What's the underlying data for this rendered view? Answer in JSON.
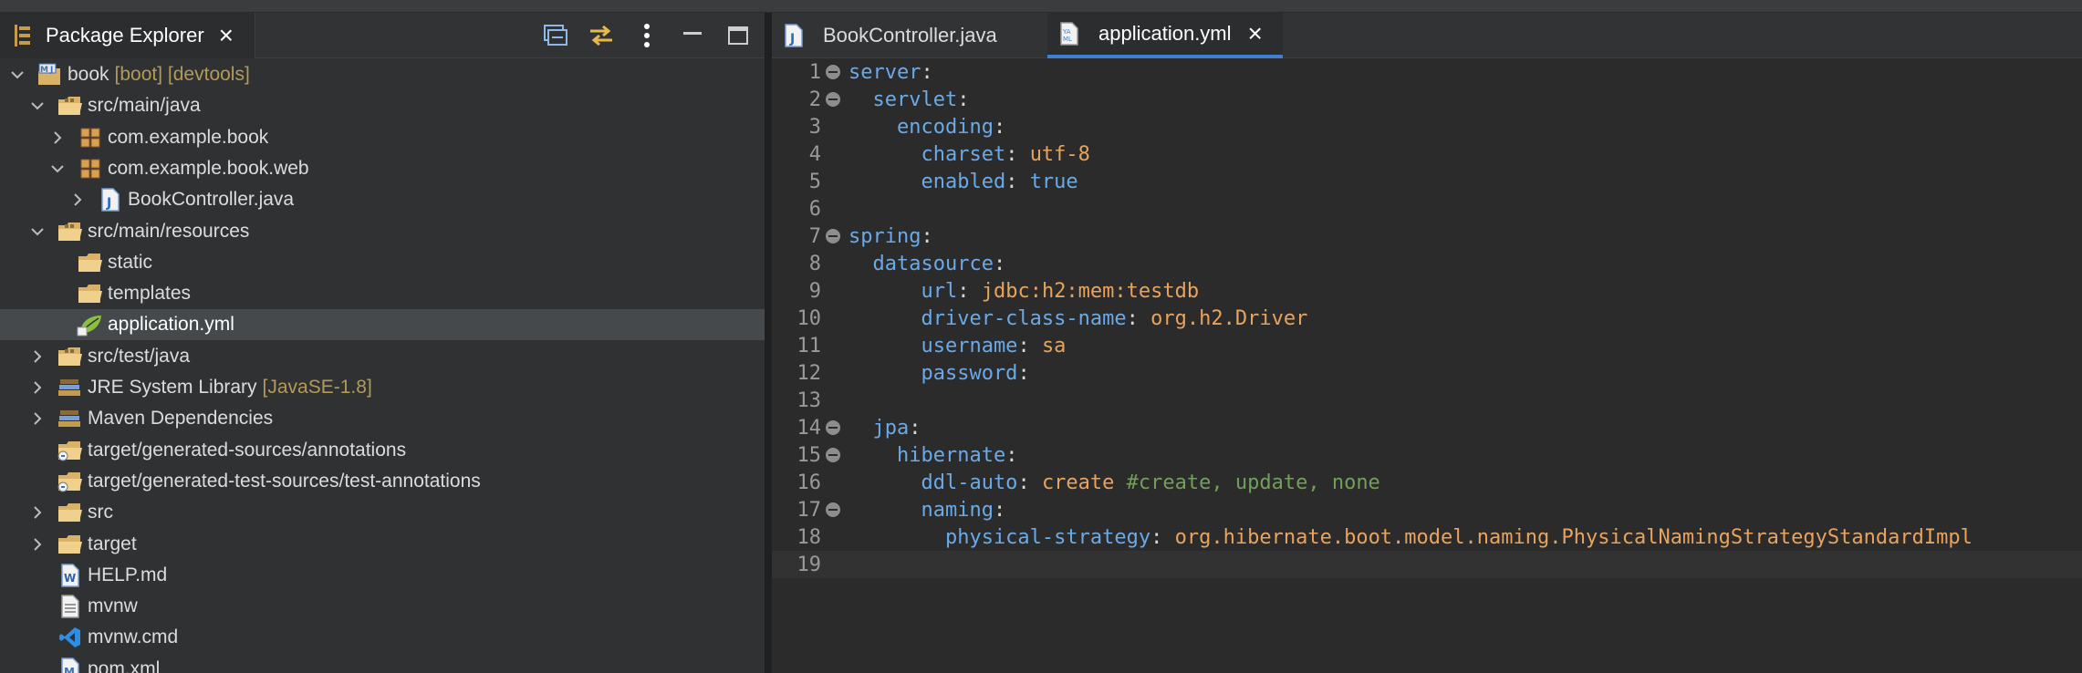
{
  "explorer": {
    "title": "Package Explorer",
    "close_glyph": "×",
    "tools": [
      "collapse-all-icon",
      "link-with-editor-icon",
      "view-menu-icon",
      "minimize-icon",
      "maximize-icon"
    ],
    "tree": [
      {
        "name": "book",
        "decoration": "[boot] [devtools]",
        "depth": 0,
        "arrow": "expanded",
        "icon": "maven-project-icon"
      },
      {
        "name": "src/main/java",
        "depth": 1,
        "arrow": "expanded",
        "icon": "source-folder-icon"
      },
      {
        "name": "com.example.book",
        "depth": 2,
        "arrow": "collapsed",
        "icon": "package-icon"
      },
      {
        "name": "com.example.book.web",
        "depth": 2,
        "arrow": "expanded",
        "icon": "package-icon"
      },
      {
        "name": "BookController.java",
        "depth": 3,
        "arrow": "collapsed",
        "icon": "java-file-icon"
      },
      {
        "name": "src/main/resources",
        "depth": 1,
        "arrow": "expanded",
        "icon": "source-folder-icon"
      },
      {
        "name": "static",
        "depth": 2,
        "arrow": "none",
        "icon": "folder-icon"
      },
      {
        "name": "templates",
        "depth": 2,
        "arrow": "none",
        "icon": "folder-icon"
      },
      {
        "name": "application.yml",
        "depth": 2,
        "arrow": "none",
        "icon": "spring-yml-icon",
        "selected": true
      },
      {
        "name": "src/test/java",
        "depth": 1,
        "arrow": "collapsed",
        "icon": "source-folder-icon"
      },
      {
        "name": "JRE System Library",
        "decoration": "[JavaSE-1.8]",
        "depth": 1,
        "arrow": "collapsed",
        "icon": "library-icon"
      },
      {
        "name": "Maven Dependencies",
        "depth": 1,
        "arrow": "collapsed",
        "icon": "library-icon"
      },
      {
        "name": "target/generated-sources/annotations",
        "depth": 1,
        "arrow": "none",
        "icon": "generated-source-folder-icon"
      },
      {
        "name": "target/generated-test-sources/test-annotations",
        "depth": 1,
        "arrow": "none",
        "icon": "generated-source-folder-icon"
      },
      {
        "name": "src",
        "depth": 1,
        "arrow": "collapsed",
        "icon": "folder-icon"
      },
      {
        "name": "target",
        "depth": 1,
        "arrow": "collapsed",
        "icon": "folder-icon"
      },
      {
        "name": "HELP.md",
        "depth": 1,
        "arrow": "none",
        "icon": "word-doc-icon"
      },
      {
        "name": "mvnw",
        "depth": 1,
        "arrow": "none",
        "icon": "text-file-icon"
      },
      {
        "name": "mvnw.cmd",
        "depth": 1,
        "arrow": "none",
        "icon": "vscode-file-icon"
      },
      {
        "name": "pom.xml",
        "depth": 1,
        "arrow": "none",
        "icon": "maven-pom-icon"
      }
    ]
  },
  "editor": {
    "tabs": [
      {
        "label": "BookController.java",
        "icon": "java-file-icon",
        "active": false
      },
      {
        "label": "application.yml",
        "icon": "yaml-file-icon",
        "active": true,
        "close_glyph": "×"
      }
    ],
    "lines": [
      {
        "n": "1",
        "fold": true,
        "tokens": [
          {
            "t": "server",
            "c": "k"
          },
          {
            "t": ":",
            "c": "p"
          }
        ]
      },
      {
        "n": "2",
        "fold": true,
        "tokens": [
          {
            "t": "  servlet",
            "c": "k"
          },
          {
            "t": ":",
            "c": "p"
          }
        ]
      },
      {
        "n": "3",
        "fold": false,
        "tokens": [
          {
            "t": "    encoding",
            "c": "k"
          },
          {
            "t": ":",
            "c": "p"
          }
        ]
      },
      {
        "n": "4",
        "fold": false,
        "tokens": [
          {
            "t": "      charset",
            "c": "k"
          },
          {
            "t": ": ",
            "c": "p"
          },
          {
            "t": "utf-8",
            "c": "v"
          }
        ]
      },
      {
        "n": "5",
        "fold": false,
        "tokens": [
          {
            "t": "      enabled",
            "c": "k"
          },
          {
            "t": ": ",
            "c": "p"
          },
          {
            "t": "true",
            "c": "k"
          }
        ]
      },
      {
        "n": "6",
        "fold": false,
        "tokens": []
      },
      {
        "n": "7",
        "fold": true,
        "tokens": [
          {
            "t": "spring",
            "c": "k"
          },
          {
            "t": ":",
            "c": "p"
          }
        ]
      },
      {
        "n": "8",
        "fold": false,
        "tokens": [
          {
            "t": "  datasource",
            "c": "k"
          },
          {
            "t": ":",
            "c": "p"
          }
        ]
      },
      {
        "n": "9",
        "fold": false,
        "tokens": [
          {
            "t": "      url",
            "c": "k"
          },
          {
            "t": ": ",
            "c": "p"
          },
          {
            "t": "jdbc:h2:mem:testdb",
            "c": "v"
          }
        ]
      },
      {
        "n": "10",
        "fold": false,
        "tokens": [
          {
            "t": "      driver-class-name",
            "c": "k"
          },
          {
            "t": ": ",
            "c": "p"
          },
          {
            "t": "org.h2.Driver",
            "c": "v"
          }
        ]
      },
      {
        "n": "11",
        "fold": false,
        "tokens": [
          {
            "t": "      username",
            "c": "k"
          },
          {
            "t": ": ",
            "c": "p"
          },
          {
            "t": "sa",
            "c": "v"
          }
        ]
      },
      {
        "n": "12",
        "fold": false,
        "tokens": [
          {
            "t": "      password",
            "c": "k"
          },
          {
            "t": ":",
            "c": "p"
          }
        ]
      },
      {
        "n": "13",
        "fold": false,
        "tokens": []
      },
      {
        "n": "14",
        "fold": true,
        "tokens": [
          {
            "t": "  jpa",
            "c": "k"
          },
          {
            "t": ":",
            "c": "p"
          }
        ]
      },
      {
        "n": "15",
        "fold": true,
        "tokens": [
          {
            "t": "    hibernate",
            "c": "k"
          },
          {
            "t": ":",
            "c": "p"
          }
        ]
      },
      {
        "n": "16",
        "fold": false,
        "tokens": [
          {
            "t": "      ddl-auto",
            "c": "k"
          },
          {
            "t": ": ",
            "c": "p"
          },
          {
            "t": "create ",
            "c": "v"
          },
          {
            "t": "#create, update, none",
            "c": "c"
          }
        ]
      },
      {
        "n": "17",
        "fold": true,
        "tokens": [
          {
            "t": "      naming",
            "c": "k"
          },
          {
            "t": ":",
            "c": "p"
          }
        ]
      },
      {
        "n": "18",
        "fold": false,
        "tokens": [
          {
            "t": "        physical-strategy",
            "c": "k"
          },
          {
            "t": ": ",
            "c": "p"
          },
          {
            "t": "org.hibernate.boot.model.naming.PhysicalNamingStrategyStandardImpl",
            "c": "v"
          }
        ]
      },
      {
        "n": "19",
        "fold": false,
        "tokens": [],
        "current": true
      }
    ]
  },
  "colors": {
    "yaml_key": "#6aaae8",
    "yaml_value": "#e8a35e",
    "yaml_comment": "#71a05b",
    "decoration": "#b39a57",
    "selection": "#45494c"
  }
}
